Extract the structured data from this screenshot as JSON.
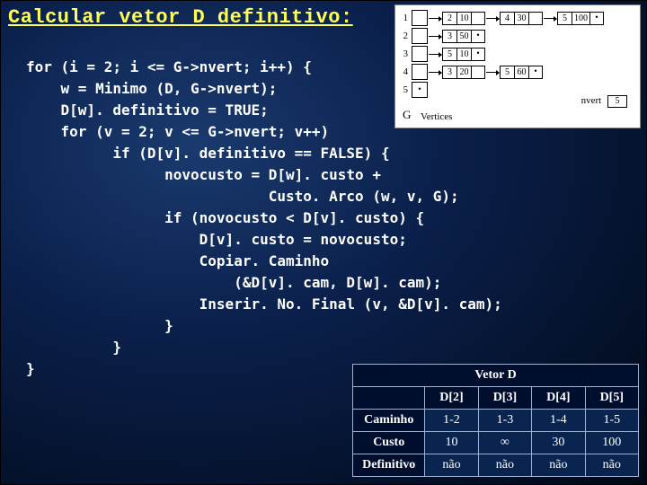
{
  "title": "Calcular vetor D definitivo:",
  "code": "for (i = 2; i <= G->nvert; i++) {\n    w = Minimo (D, G->nvert);\n    D[w]. definitivo = TRUE;\n    for (v = 2; v <= G->nvert; v++)\n          if (D[v]. definitivo == FALSE) {\n                novocusto = D[w]. custo +\n                            Custo. Arco (w, v, G);\n                if (novocusto < D[v]. custo) {\n                    D[v]. custo = novocusto;\n                    Copiar. Caminho\n                        (&D[v]. cam, D[w]. cam);\n                    Inserir. No. Final (v, &D[v]. cam);\n                }\n          }\n}",
  "graph": {
    "vertices_label": "Vertices",
    "nvert_label": "nvert",
    "nvert_value": "5",
    "g_label": "G",
    "rows": [
      {
        "idx": "1",
        "nodes": [
          [
            "2",
            "10"
          ],
          [
            "4",
            "30"
          ],
          [
            "5",
            "100"
          ]
        ]
      },
      {
        "idx": "2",
        "nodes": [
          [
            "3",
            "50"
          ]
        ]
      },
      {
        "idx": "3",
        "nodes": [
          [
            "5",
            "10"
          ]
        ]
      },
      {
        "idx": "4",
        "nodes": [
          [
            "3",
            "20"
          ],
          [
            "5",
            "60"
          ]
        ]
      },
      {
        "idx": "5",
        "nodes": []
      }
    ]
  },
  "vector_d": {
    "title": "Vetor D",
    "columns": [
      "D[2]",
      "D[3]",
      "D[4]",
      "D[5]"
    ],
    "rows": [
      {
        "label": "Caminho",
        "values": [
          "1-2",
          "1-3",
          "1-4",
          "1-5"
        ]
      },
      {
        "label": "Custo",
        "values": [
          "10",
          "∞",
          "30",
          "100"
        ]
      },
      {
        "label": "Definitivo",
        "values": [
          "não",
          "não",
          "não",
          "não"
        ]
      }
    ]
  }
}
